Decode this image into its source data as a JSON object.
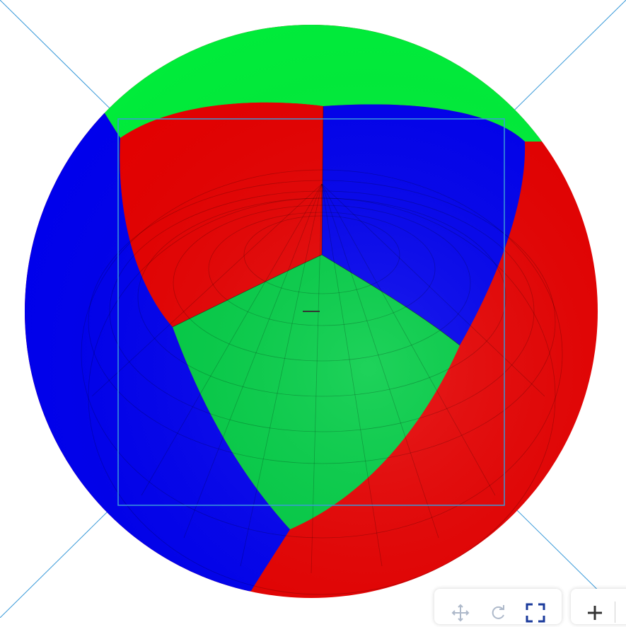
{
  "viewer": {
    "colors": {
      "red": "#e60000",
      "green_top": "#00ee3a",
      "green_front": "#00cc44",
      "blue": "#0000ee",
      "selection_outline": "#3a9ad9",
      "grid_lines": "#000000"
    }
  },
  "toolbar": {
    "tools": [
      {
        "icon": "move-icon",
        "enabled": false
      },
      {
        "icon": "redo-icon",
        "enabled": false
      },
      {
        "icon": "fullscreen-icon",
        "enabled": true
      }
    ],
    "zoom": {
      "icon": "zoom-in-icon"
    }
  }
}
